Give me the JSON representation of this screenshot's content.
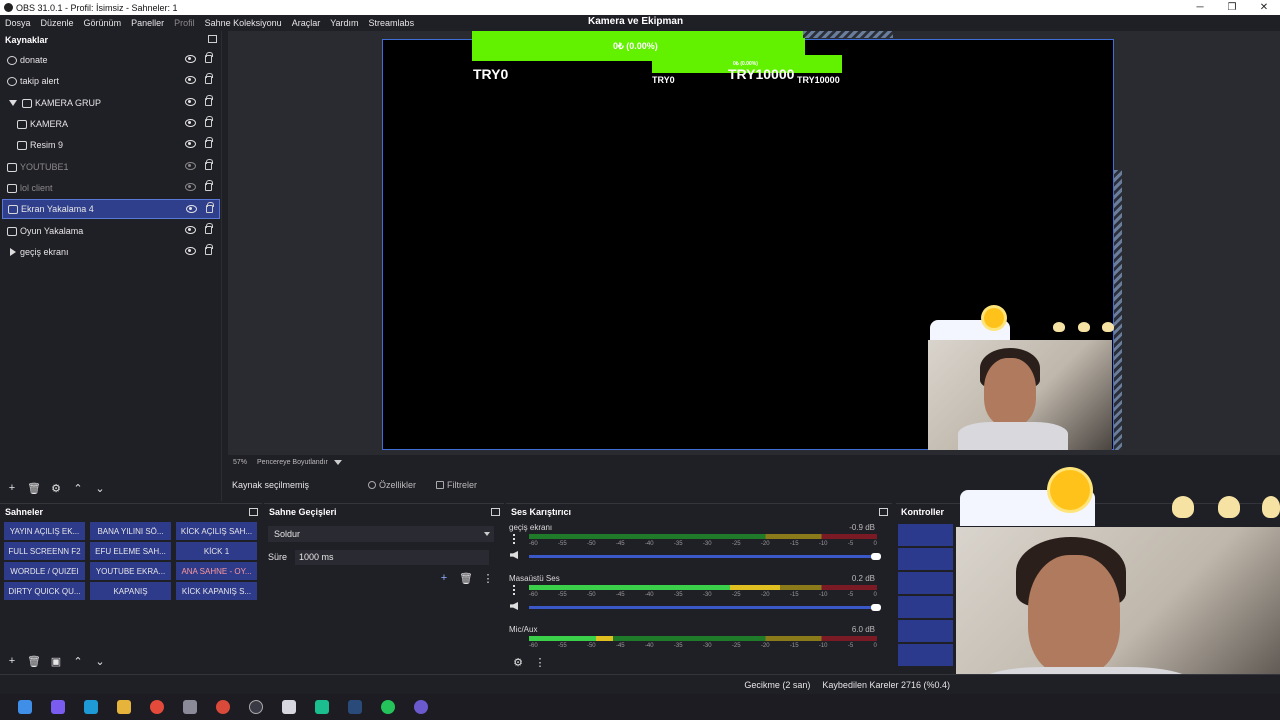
{
  "window": {
    "title": "OBS 31.0.1 - Profil: İsimsiz - Sahneler: 1",
    "min": "─",
    "max": "❐",
    "close": "✕"
  },
  "menu": [
    "Dosya",
    "Düzenle",
    "Görünüm",
    "Paneller",
    "Profil",
    "Sahne Koleksiyonu",
    "Araçlar",
    "Yardım",
    "Streamlabs"
  ],
  "preview": {
    "scene_label": "Kamera ve Ekipman",
    "goal_text": "0₺ (0.00%)",
    "goal_small": "0₺ (0.00%)",
    "try_left": "TRY0",
    "try_mid_small": "TRY0",
    "try_right_big": "TRY10000",
    "try_right_small": "TRY10000",
    "zoom": "57%",
    "zoom_mode": "Pencereye Boyutlandır",
    "accent": "#62f200"
  },
  "sources": {
    "title": "Kaynaklar",
    "items": [
      {
        "label": "donate",
        "icon": "browser-icon",
        "visible": true
      },
      {
        "label": "takip alert",
        "icon": "browser-icon",
        "visible": true
      },
      {
        "label": "KAMERA GRUP",
        "icon": "folder-icon",
        "visible": true
      },
      {
        "label": "KAMERA",
        "icon": "camera-icon",
        "visible": true
      },
      {
        "label": "Resim 9",
        "icon": "image-icon",
        "visible": true
      },
      {
        "label": "YOUTUBE1",
        "icon": "monitor-icon",
        "visible": false
      },
      {
        "label": "lol client",
        "icon": "window-icon",
        "visible": false
      },
      {
        "label": "Ekran Yakalama 4",
        "icon": "monitor-icon",
        "visible": true
      },
      {
        "label": "Oyun Yakalama",
        "icon": "gamepad-icon",
        "visible": true
      },
      {
        "label": "geçiş ekranı",
        "icon": "play-icon",
        "visible": true
      }
    ]
  },
  "properties_bar": {
    "no_selection": "Kaynak seçilmemiş",
    "properties": "Özellikler",
    "filters": "Filtreler"
  },
  "scenes": {
    "title": "Sahneler",
    "buttons": [
      "YAYIN AÇILIŞ EK...",
      "BANA YILINI SÖ...",
      "KİCK AÇILIŞ SAH...",
      "FULL SCREENN F2",
      "EFU ELEME SAH...",
      "KİCK 1",
      "WORDLE / QUIZEI",
      "YOUTUBE EKRA...",
      "ANA SAHNE - OY...",
      "DIRTY QUICK QU...",
      "KAPANIŞ",
      "KİCK KAPANIŞ S..."
    ],
    "active_index": 8
  },
  "transitions": {
    "title": "Sahne Geçişleri",
    "type": "Soldur",
    "duration_label": "Süre",
    "duration": "1000 ms"
  },
  "mixer": {
    "title": "Ses Karıştırıcı",
    "ticks": [
      "-60",
      "-55",
      "-50",
      "-45",
      "-40",
      "-35",
      "-30",
      "-25",
      "-20",
      "-15",
      "-10",
      "-5",
      "0"
    ],
    "channels": [
      {
        "name": "geçiş ekranı",
        "db": "-0.9 dB",
        "level": 0.0
      },
      {
        "name": "Masaüstü Ses",
        "db": "0.2 dB",
        "level": 0.72
      },
      {
        "name": "Mic/Aux",
        "db": "6.0 dB",
        "level": 0.24
      }
    ]
  },
  "controls": {
    "title": "Kontroller"
  },
  "status": {
    "delay": "Gecikme (2 san)",
    "dropped": "Kaybedilen Kareler 2716 (%0.4)"
  }
}
